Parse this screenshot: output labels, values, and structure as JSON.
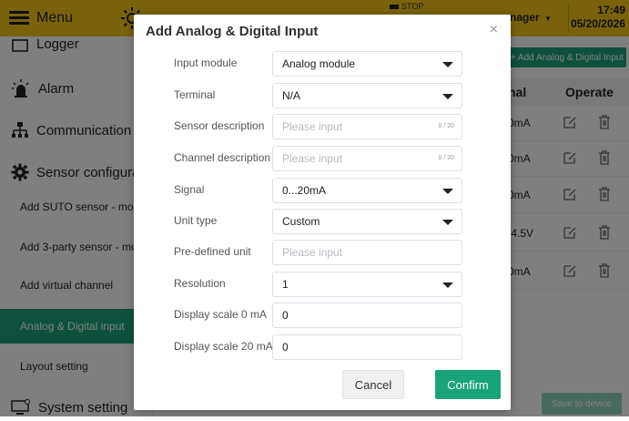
{
  "topbar": {
    "menu_label": "Menu",
    "stop_label": "STOP",
    "user_label": "nager",
    "time": "17:49",
    "date": "05/20/2026"
  },
  "sidebar": {
    "items": [
      {
        "label": "Logger",
        "icon": "logger-icon"
      },
      {
        "label": "Alarm",
        "icon": "alarm-icon"
      },
      {
        "label": "Communication",
        "icon": "network-icon"
      },
      {
        "label": "Sensor configura",
        "icon": "gear-icon"
      },
      {
        "label": "Add SUTO sensor - mo"
      },
      {
        "label": "Add 3-party sensor - mo"
      },
      {
        "label": "Add virtual channel"
      },
      {
        "label": "Analog & Digital input"
      },
      {
        "label": "Layout setting"
      },
      {
        "label": "System setting",
        "icon": "monitor-icon"
      }
    ]
  },
  "content": {
    "add_button_label": "+ Add Analog & Digital Input",
    "columns": {
      "signal": "nal",
      "operate": "Operate"
    },
    "rows": [
      {
        "signal": "0mA"
      },
      {
        "signal": "0mA"
      },
      {
        "signal": "0mA"
      },
      {
        "signal": ".4.5V"
      },
      {
        "signal": "0mA"
      }
    ],
    "save_button_label": "Save to device"
  },
  "dialog": {
    "title": "Add Analog & Digital Input",
    "close_icon": "×",
    "fields": {
      "input_module": {
        "label": "Input module",
        "value": "Analog module"
      },
      "terminal": {
        "label": "Terminal",
        "value": "N/A"
      },
      "sensor_description": {
        "label": "Sensor description",
        "placeholder": "Please input",
        "counter": "0 / 20"
      },
      "channel_description": {
        "label": "Channel description",
        "placeholder": "Please input",
        "counter": "0 / 20"
      },
      "signal": {
        "label": "Signal",
        "value": "0...20mA"
      },
      "unit_type": {
        "label": "Unit type",
        "value": "Custom"
      },
      "predefined_unit": {
        "label": "Pre-defined unit",
        "placeholder": "Please input"
      },
      "resolution": {
        "label": "Resolution",
        "value": "1"
      },
      "display_scale_0": {
        "label": "Display scale 0 mA",
        "value": "0"
      },
      "display_scale_20": {
        "label": "Display scale 20 mA",
        "value": "0"
      }
    },
    "cancel_label": "Cancel",
    "confirm_label": "Confirm"
  },
  "colors": {
    "accent": "#1aa37a",
    "topbar": "#f4c417"
  }
}
